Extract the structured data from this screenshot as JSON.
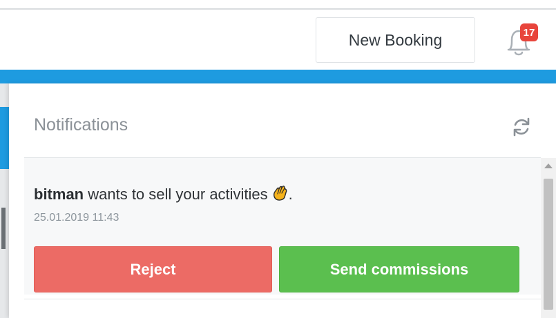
{
  "header": {
    "new_booking_label": "New Booking",
    "notification_count": "17"
  },
  "notifications_panel": {
    "title": "Notifications",
    "items": [
      {
        "user": "bitman",
        "message": " wants to sell your activities",
        "message_end": ".",
        "emoji_icon": "waving-hand-icon",
        "timestamp": "25.01.2019 11:43",
        "reject_label": "Reject",
        "send_commissions_label": "Send commissions"
      }
    ]
  },
  "colors": {
    "accent_blue": "#1e9be0",
    "badge_red": "#e8453c",
    "reject_red": "#ec6b65",
    "send_green": "#5bbf4f"
  }
}
